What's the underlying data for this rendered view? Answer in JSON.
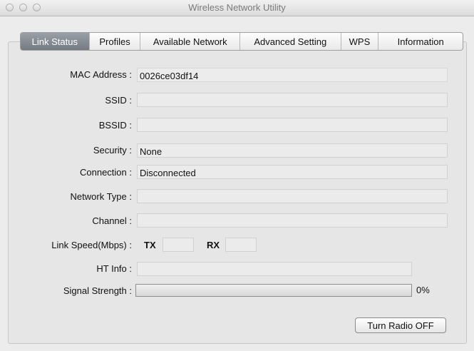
{
  "window": {
    "title": "Wireless Network Utility"
  },
  "tabs": [
    {
      "label": "Link Status",
      "active": true
    },
    {
      "label": "Profiles",
      "active": false
    },
    {
      "label": "Available Network",
      "active": false
    },
    {
      "label": "Advanced Setting",
      "active": false
    },
    {
      "label": "WPS",
      "active": false
    },
    {
      "label": "Information",
      "active": false
    }
  ],
  "fields": {
    "mac": {
      "label": "MAC Address :",
      "value": "0026ce03df14"
    },
    "ssid": {
      "label": "SSID :",
      "value": ""
    },
    "bssid": {
      "label": "BSSID :",
      "value": ""
    },
    "security": {
      "label": "Security :",
      "value": "None"
    },
    "connection": {
      "label": "Connection :",
      "value": "Disconnected"
    },
    "network_type": {
      "label": "Network Type :",
      "value": ""
    },
    "channel": {
      "label": "Channel :",
      "value": ""
    },
    "link_speed": {
      "label": "Link Speed(Mbps) :",
      "tx_label": "TX",
      "rx_label": "RX",
      "tx_value": "",
      "rx_value": ""
    },
    "ht_info": {
      "label": "HT Info :",
      "value": ""
    },
    "signal": {
      "label": "Signal Strength :",
      "percent_text": "0%",
      "value": 0
    }
  },
  "actions": {
    "radio_button": "Turn Radio OFF"
  },
  "icons": [
    "close-icon",
    "minimize-icon",
    "zoom-icon"
  ]
}
